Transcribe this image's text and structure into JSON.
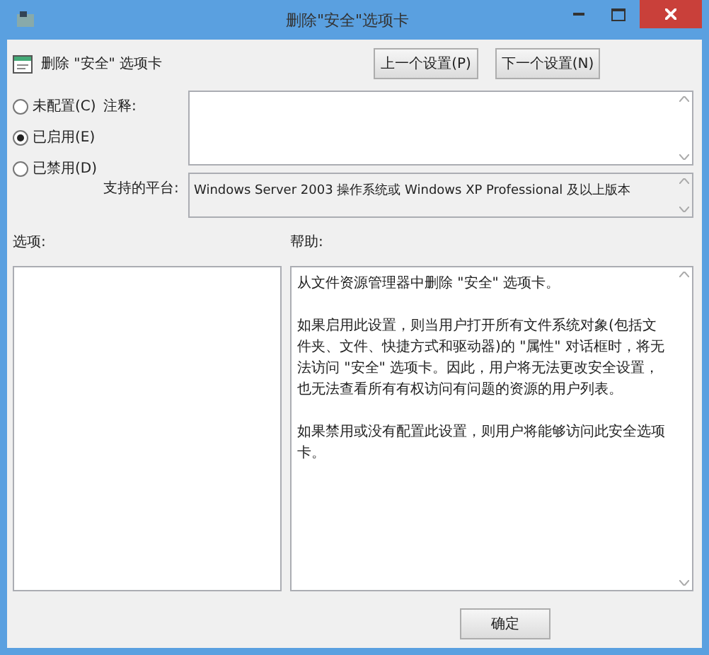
{
  "window": {
    "title": "删除\"安全\"选项卡"
  },
  "policy": {
    "title": "删除 \"安全\" 选项卡"
  },
  "nav_buttons": [
    "上一个设置(P)",
    "下一个设置(N)"
  ],
  "radios": [
    {
      "label": "未配置(C)",
      "selected": false
    },
    {
      "label": "已启用(E)",
      "selected": true
    },
    {
      "label": "已禁用(D)",
      "selected": false
    }
  ],
  "comment": {
    "label": "注释:"
  },
  "platform": {
    "label": "支持的平台:",
    "value": "Windows Server 2003 操作系统或 Windows XP Professional 及以上版本"
  },
  "options": {
    "label": "选项:"
  },
  "help": {
    "label": "帮助:",
    "paragraphs": [
      "从文件资源管理器中删除 \"安全\" 选项卡。",
      "如果启用此设置，则当用户打开所有文件系统对象(包括文件夹、文件、快捷方式和驱动器)的 \"属性\" 对话框时，将无法访问 \"安全\" 选项卡。因此，用户将无法更改安全设置，也无法查看所有有权访问有问题的资源的用户列表。",
      "如果禁用或没有配置此设置，则用户将能够访问此安全选项卡。"
    ]
  },
  "buttons": [
    "确定"
  ]
}
